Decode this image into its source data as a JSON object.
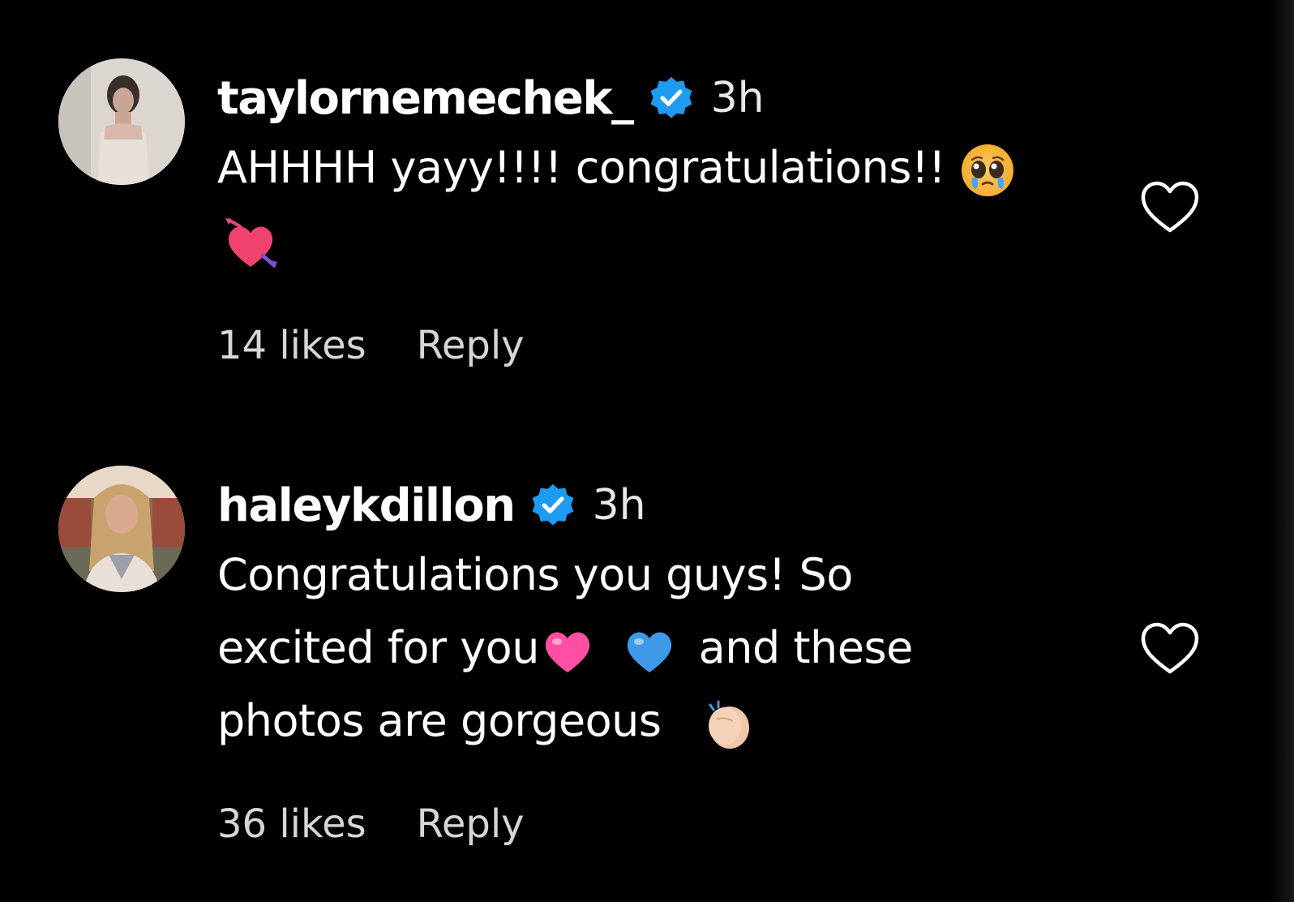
{
  "comments": [
    {
      "username": "taylornemechek_",
      "verified_icon": "verified-badge-icon",
      "time": "3h",
      "text_line1": "AHHHH yayy!!!! congratulations!!",
      "emojis": [
        "pleading-face-emoji",
        "heart-with-arrow-emoji"
      ],
      "likes": "14 likes",
      "reply_label": "Reply",
      "like_icon": "heart-outline-icon"
    },
    {
      "username": "haleykdillon",
      "verified_icon": "verified-badge-icon",
      "time": "3h",
      "text_line1": "Congratulations you guys! So",
      "text_line2a": "excited for you",
      "text_line2b": "and these",
      "text_line3": "photos are gorgeous",
      "emojis": [
        "pink-heart-emoji",
        "blue-heart-emoji",
        "clapping-hands-emoji"
      ],
      "likes": "36 likes",
      "reply_label": "Reply",
      "like_icon": "heart-outline-icon"
    }
  ],
  "colors": {
    "background": "#000000",
    "text": "#ffffff",
    "secondary_text": "#d6d6d6",
    "verified_blue": "#1d9bf0"
  }
}
